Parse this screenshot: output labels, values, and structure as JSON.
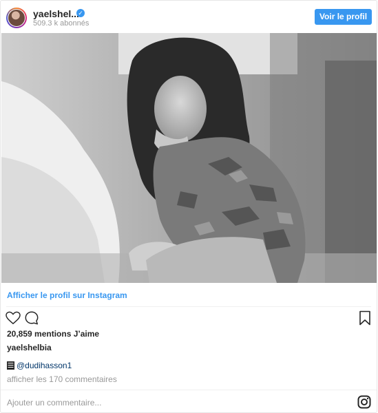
{
  "header": {
    "username": "yaelshel...",
    "followers": "509.3 k abonnés",
    "view_profile_label": "Voir le profil"
  },
  "post": {
    "profile_link": "Afficher le profil sur Instagram",
    "likes": "20,859 mentions J’aime",
    "caption_user": "yaelshelbia",
    "mention": "@dudihasson1",
    "view_comments": "afficher les 170 commentaires",
    "add_comment_placeholder": "Ajouter un commentaire..."
  },
  "colors": {
    "accent": "#3897f0",
    "text": "#262626",
    "muted": "#999999",
    "mention": "#003569"
  },
  "icons": [
    "heart-icon",
    "comment-icon",
    "bookmark-icon",
    "film-icon",
    "instagram-icon",
    "verified-icon"
  ]
}
